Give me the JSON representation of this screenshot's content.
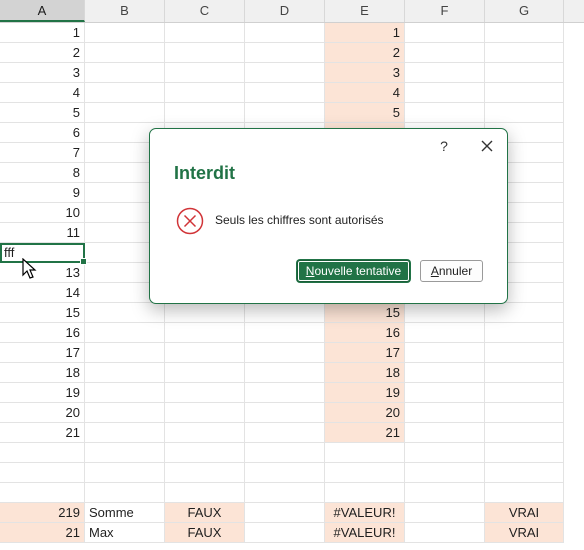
{
  "columns": [
    "A",
    "B",
    "C",
    "D",
    "E",
    "F",
    "G"
  ],
  "selected_column": "A",
  "active_cell_value": "fff",
  "rows": [
    {
      "a": "1",
      "e": "1"
    },
    {
      "a": "2",
      "e": "2"
    },
    {
      "a": "3",
      "e": "3"
    },
    {
      "a": "4",
      "e": "4"
    },
    {
      "a": "5",
      "e": "5"
    },
    {
      "a": "6",
      "e": ""
    },
    {
      "a": "7",
      "e": ""
    },
    {
      "a": "8",
      "e": ""
    },
    {
      "a": "9",
      "e": ""
    },
    {
      "a": "10",
      "e": ""
    },
    {
      "a": "11",
      "e": ""
    },
    {
      "a": "",
      "e": ""
    },
    {
      "a": "13",
      "e": ""
    },
    {
      "a": "14",
      "e": ""
    },
    {
      "a": "15",
      "e": "15"
    },
    {
      "a": "16",
      "e": "16"
    },
    {
      "a": "17",
      "e": "17"
    },
    {
      "a": "18",
      "e": "18"
    },
    {
      "a": "19",
      "e": "19"
    },
    {
      "a": "20",
      "e": "20"
    },
    {
      "a": "21",
      "e": "21"
    }
  ],
  "summary": [
    {
      "a": "219",
      "b": "Somme",
      "c": "FAUX",
      "e": "#VALEUR!",
      "g": "VRAI"
    },
    {
      "a": "21",
      "b": "Max",
      "c": "FAUX",
      "e": "#VALEUR!",
      "g": "VRAI"
    }
  ],
  "dialog": {
    "help": "?",
    "title": "Interdit",
    "message": "Seuls les chiffres sont autorisés",
    "retry_label_first": "N",
    "retry_label_rest": "ouvelle tentative",
    "cancel_label_first": "A",
    "cancel_label_rest": "nnuler",
    "error_color": "#d13438",
    "accent_color": "#217346",
    "icons": {
      "close": "close-icon",
      "error": "error-circle-icon",
      "cursor": "mouse-cursor-icon"
    }
  }
}
